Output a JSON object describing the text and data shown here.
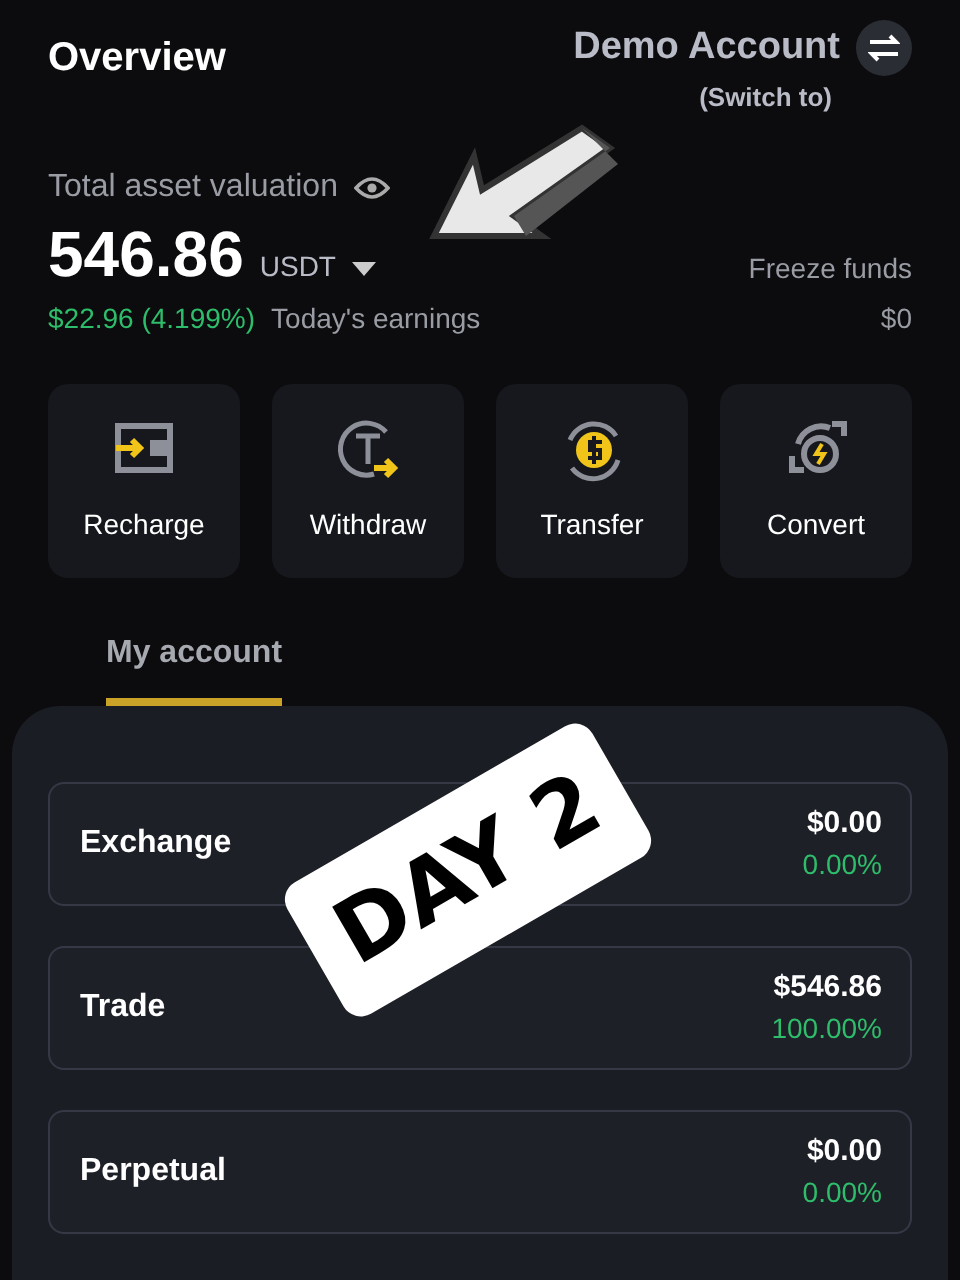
{
  "header": {
    "title": "Overview",
    "account": "Demo Account",
    "switch_hint": "(Switch to)"
  },
  "assets": {
    "label": "Total asset valuation",
    "amount": "546.86",
    "currency": "USDT",
    "earnings_value": "$22.96 (4.199%)",
    "earnings_label": "Today's earnings",
    "freeze_label": "Freeze funds",
    "freeze_value": "$0"
  },
  "actions": [
    {
      "kind": "recharge",
      "label": "Recharge"
    },
    {
      "kind": "withdraw",
      "label": "Withdraw"
    },
    {
      "kind": "transfer",
      "label": "Transfer"
    },
    {
      "kind": "convert",
      "label": "Convert"
    }
  ],
  "tabs": [
    {
      "label": "My account",
      "selected": true
    }
  ],
  "accounts": [
    {
      "name": "Exchange",
      "amount": "$0.00",
      "share": "0.00%"
    },
    {
      "name": "Trade",
      "amount": "$546.86",
      "share": "100.00%"
    },
    {
      "name": "Perpetual",
      "amount": "$0.00",
      "share": "0.00%"
    }
  ],
  "sticker": {
    "text": "DAY 2"
  }
}
